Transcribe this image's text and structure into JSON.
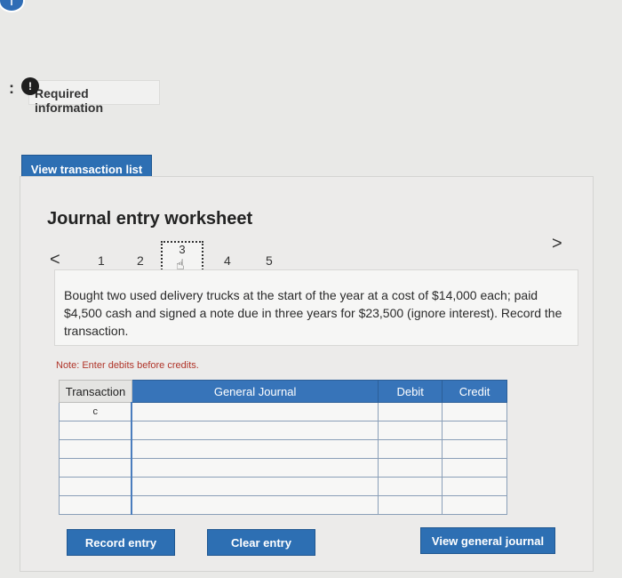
{
  "header": {
    "badge_icon": "info-icon",
    "colon": ":",
    "required_icon_label": "!",
    "required_label": "Required information"
  },
  "view_transaction_list_label": "View transaction list",
  "worksheet": {
    "title": "Journal entry worksheet",
    "nav": {
      "prev": "<",
      "next": ">",
      "pages": [
        "1",
        "2",
        "3",
        "4",
        "5"
      ],
      "selected": "3"
    },
    "description": "Bought two used delivery trucks at the start of the year at a cost of $14,000 each; paid $4,500 cash and signed a note due in three years for $23,500 (ignore interest). Record the transaction.",
    "note": "Note: Enter debits before credits.",
    "table": {
      "headers": [
        "Transaction",
        "General Journal",
        "Debit",
        "Credit"
      ],
      "rows": [
        {
          "transaction": "c",
          "account": "",
          "debit": "",
          "credit": ""
        },
        {
          "transaction": "",
          "account": "",
          "debit": "",
          "credit": ""
        },
        {
          "transaction": "",
          "account": "",
          "debit": "",
          "credit": ""
        },
        {
          "transaction": "",
          "account": "",
          "debit": "",
          "credit": ""
        },
        {
          "transaction": "",
          "account": "",
          "debit": "",
          "credit": ""
        },
        {
          "transaction": "",
          "account": "",
          "debit": "",
          "credit": ""
        }
      ]
    },
    "buttons": {
      "record": "Record entry",
      "clear": "Clear entry",
      "view_general_journal": "View general journal"
    }
  },
  "colors": {
    "accent": "#2d6fb3",
    "header_blue": "#3774b9",
    "note_red": "#b0352a"
  }
}
